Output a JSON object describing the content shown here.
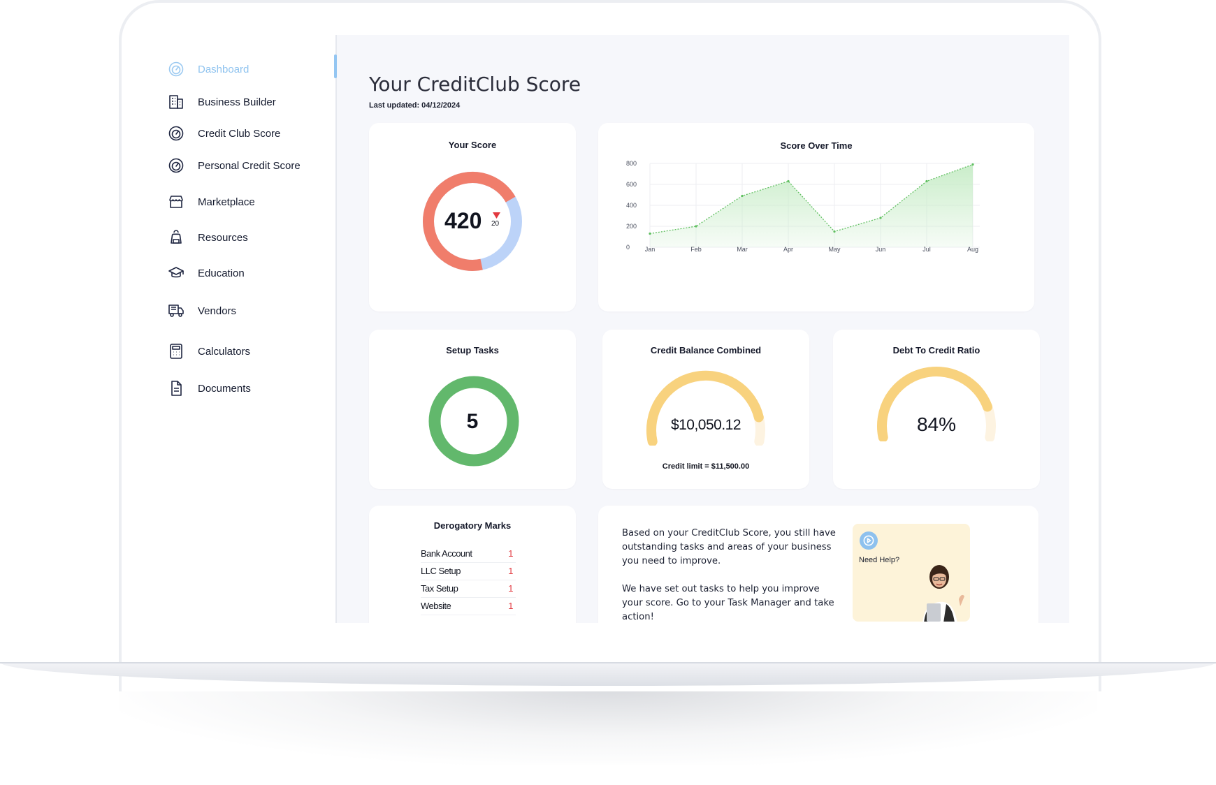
{
  "sidebar": {
    "items": [
      {
        "label": "Dashboard",
        "icon": "gauge-icon",
        "active": true
      },
      {
        "label": "Business Builder",
        "icon": "building-icon"
      },
      {
        "label": "Credit Club Score",
        "icon": "gauge-icon"
      },
      {
        "label": "Personal Credit Score",
        "icon": "gauge-icon"
      },
      {
        "label": "Marketplace",
        "icon": "storefront-icon"
      },
      {
        "label": "Resources",
        "icon": "backpack-icon"
      },
      {
        "label": "Education",
        "icon": "graduation-cap-icon"
      },
      {
        "label": "Vendors",
        "icon": "truck-icon"
      },
      {
        "label": "Calculators",
        "icon": "calculator-icon"
      },
      {
        "label": "Documents",
        "icon": "document-icon"
      }
    ]
  },
  "header": {
    "title": "Your CreditClub Score",
    "last_updated": "Last updated: 04/12/2024"
  },
  "your_score": {
    "title": "Your Score",
    "score": "420",
    "change": "20",
    "change_direction": "down",
    "segments": [
      {
        "name": "filled",
        "fraction": 0.7,
        "color": "#f07d6b"
      },
      {
        "name": "remaining",
        "fraction": 0.3,
        "color": "#bcd3f8"
      }
    ],
    "delta_color": "#e2393f"
  },
  "score_over_time": {
    "title": "Score Over Time"
  },
  "chart_data": {
    "type": "area",
    "title": "Score Over Time",
    "categories": [
      "Jan",
      "Feb",
      "Mar",
      "Apr",
      "May",
      "Jun",
      "Jul",
      "Aug"
    ],
    "values": [
      130,
      200,
      490,
      630,
      150,
      280,
      630,
      790
    ],
    "yticks": [
      0,
      200,
      400,
      600,
      800
    ],
    "ylim": [
      0,
      800
    ],
    "grid": true,
    "color": "#5fbf5f",
    "fill": "#c7ecc7"
  },
  "setup_tasks": {
    "title": "Setup Tasks",
    "value": "5",
    "color": "#62b86c"
  },
  "credit_balance": {
    "title": "Credit Balance Combined",
    "value": "$10,050.12",
    "subtitle": "Credit limit = $11,500.00",
    "fraction": 0.874,
    "color": "#f8d27e",
    "track_color": "#fdf3e1"
  },
  "debt_ratio": {
    "title": "Debt To Credit Ratio",
    "value": "84%",
    "fraction": 0.84,
    "color": "#f8d27e",
    "track_color": "#fdf3e1"
  },
  "derogatory": {
    "title": "Derogatory Marks",
    "rows": [
      {
        "label": "Bank Account",
        "count": "1"
      },
      {
        "label": "LLC Setup",
        "count": "1"
      },
      {
        "label": "Tax Setup",
        "count": "1"
      },
      {
        "label": "Website",
        "count": "1"
      }
    ]
  },
  "help": {
    "paragraph1": "Based on your CreditClub Score, you still have outstanding tasks and areas of your business you need to improve.",
    "paragraph2": "We have set out tasks to help you improve your score. Go to your Task Manager and take action!",
    "need_help": "Need Help?"
  },
  "colors": {
    "accent": "#8fc3ef",
    "background": "#f6f7fb"
  }
}
